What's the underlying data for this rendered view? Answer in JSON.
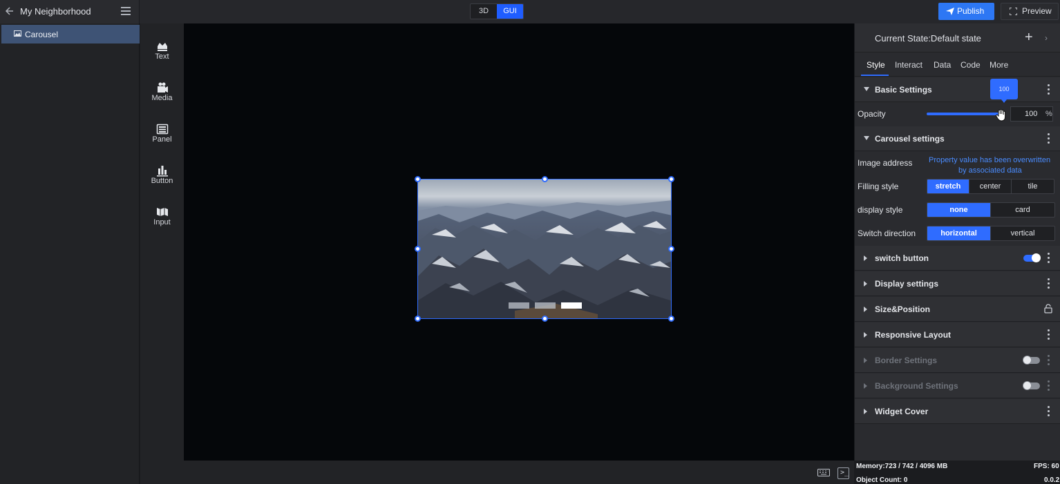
{
  "header": {
    "project_title": "My Neighborhood",
    "mode_3d": "3D",
    "mode_gui": "GUI",
    "publish_label": "Publish",
    "preview_label": "Preview",
    "active_mode": "GUI",
    "accent_color": "#2f6cff"
  },
  "layers": {
    "items": [
      {
        "label": "Carousel",
        "icon": "image-icon",
        "selected": true
      }
    ]
  },
  "widgets": {
    "items": [
      {
        "label": "Text",
        "icon": "text-icon"
      },
      {
        "label": "Media",
        "icon": "media-icon"
      },
      {
        "label": "Panel",
        "icon": "panel-icon"
      },
      {
        "label": "Button",
        "icon": "button-icon"
      },
      {
        "label": "Input",
        "icon": "input-icon"
      }
    ]
  },
  "canvas": {
    "carousel_indicators": 3,
    "active_indicator": 3
  },
  "properties": {
    "state_label": "Current State:Default state",
    "tabs": [
      {
        "label": "Style",
        "active": true
      },
      {
        "label": "Interact"
      },
      {
        "label": "Data"
      },
      {
        "label": "Code"
      },
      {
        "label": "More"
      }
    ],
    "basic_settings": {
      "title": "Basic Settings",
      "opacity_label": "Opacity",
      "opacity_value": "100",
      "opacity_unit": "%",
      "slider_tooltip": "100",
      "opacity_fraction": 1.0
    },
    "carousel_settings": {
      "title": "Carousel settings",
      "image_address_label": "Image address",
      "image_address_line1": "Property value has been overwritten",
      "image_address_line2": "by associated data",
      "filling_style_label": "Filling style",
      "filling_options": [
        "stretch",
        "center",
        "tile"
      ],
      "filling_selected": "stretch",
      "display_style_label": "display style",
      "display_options": [
        "none",
        "card"
      ],
      "display_selected": "none",
      "switch_direction_label": "Switch direction",
      "direction_options": [
        "horizontal",
        "vertical"
      ],
      "direction_selected": "horizontal"
    },
    "sections": [
      {
        "title": "switch button",
        "toggle": "on"
      },
      {
        "title": "Display settings"
      },
      {
        "title": "Size&Position",
        "lock": true
      },
      {
        "title": "Responsive Layout"
      },
      {
        "title": "Border Settings",
        "toggle": "off",
        "disabled": true
      },
      {
        "title": "Background Settings",
        "toggle": "off",
        "disabled": true
      },
      {
        "title": "Widget Cover"
      }
    ]
  },
  "status": {
    "memory": "Memory:723 / 742 / 4096 MB",
    "fps": "FPS: 60",
    "object_count": "Object Count: 0",
    "version": "0.0.2"
  }
}
